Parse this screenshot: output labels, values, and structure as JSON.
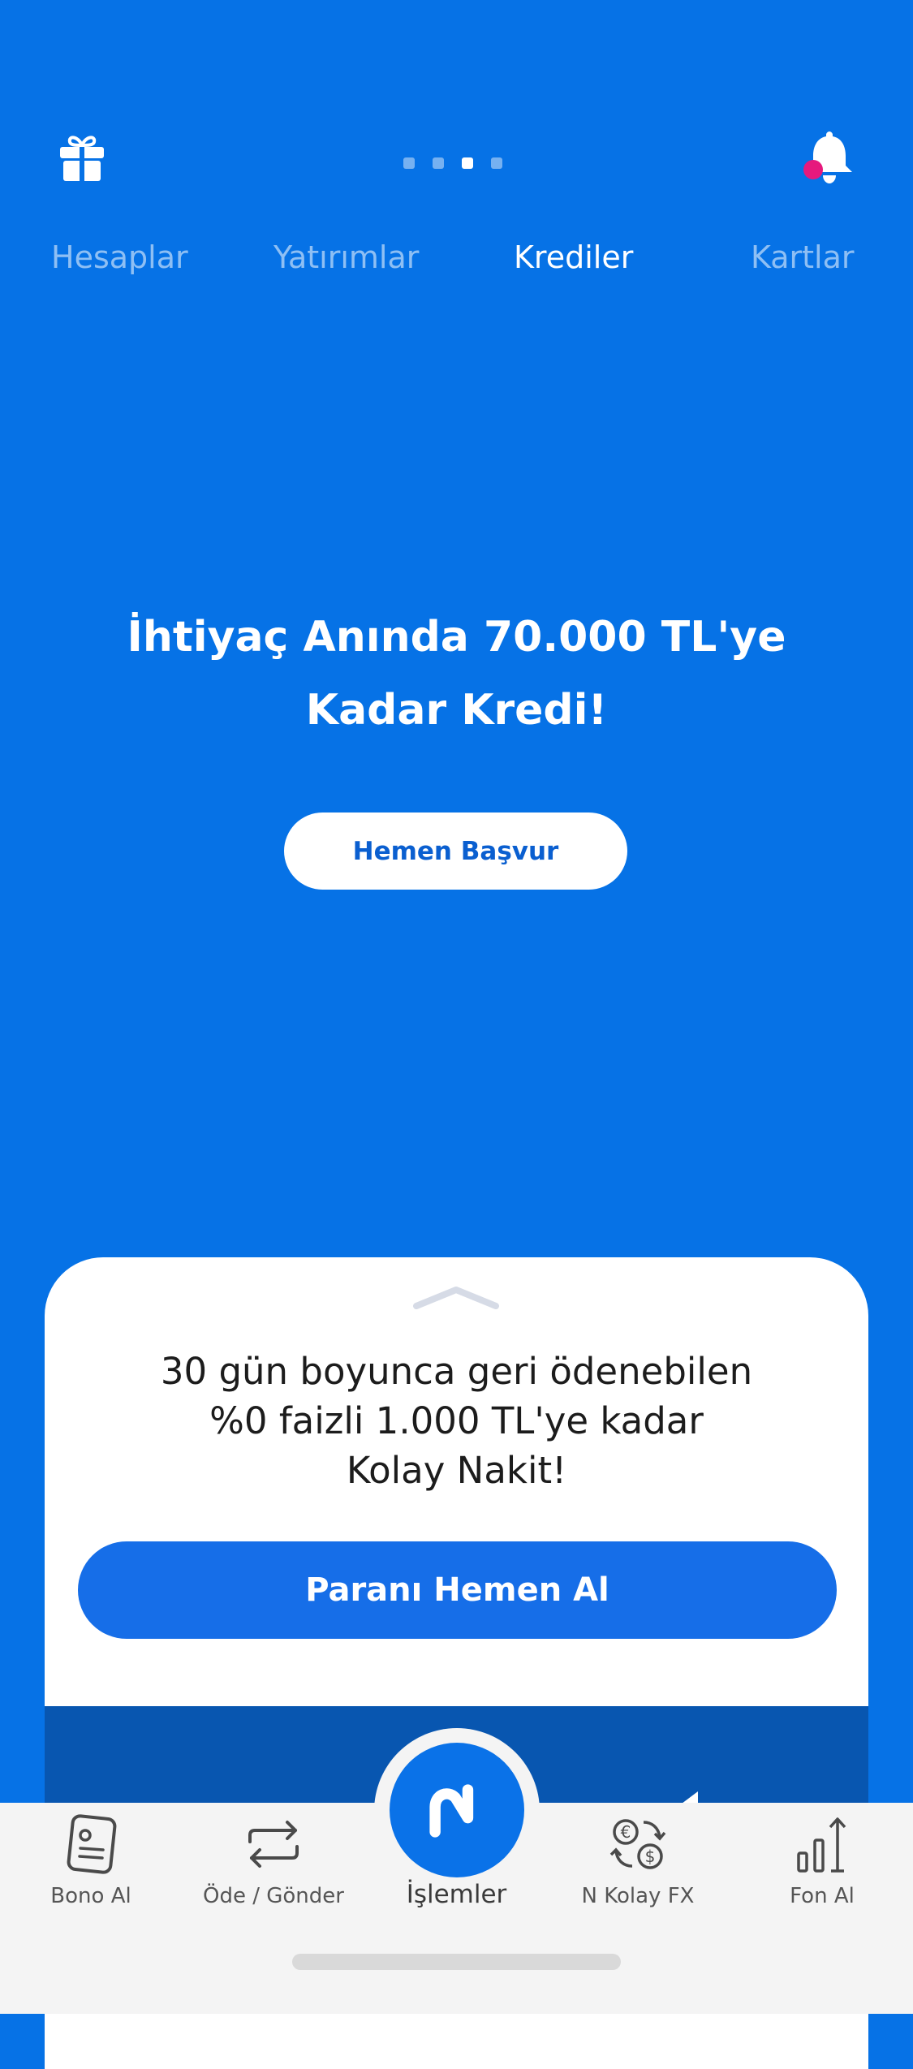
{
  "header": {
    "gift_icon": "gift-icon",
    "bell_icon": "bell-icon",
    "notification_badge_color": "#e6197d",
    "page_indicator": {
      "count": 4,
      "active_index": 2
    }
  },
  "tabs": [
    {
      "label": "Hesaplar",
      "active": false
    },
    {
      "label": "Yatırımlar",
      "active": false
    },
    {
      "label": "Krediler",
      "active": true
    },
    {
      "label": "Kartlar",
      "active": false
    }
  ],
  "hero": {
    "title": "İhtiyaç Anında 70.000 TL'ye Kadar Kredi!",
    "button_label": "Hemen Başvur"
  },
  "sheet": {
    "handle_icon": "chevron-up-icon",
    "text_lines": [
      "30 gün boyunca geri ödenebilen",
      "%0 faizli 1.000 TL'ye kadar",
      "Kolay Nakit!"
    ],
    "button_label": "Paranı Hemen Al"
  },
  "bottom_nav": {
    "items": [
      {
        "label": "Bono Al",
        "icon": "document-icon"
      },
      {
        "label": "Öde / Gönder",
        "icon": "transfer-arrows-icon"
      },
      {
        "label": "N Kolay FX",
        "icon": "currency-exchange-icon"
      },
      {
        "label": "Fon Al",
        "icon": "bar-chart-up-icon"
      }
    ],
    "center": {
      "label": "İşlemler",
      "icon": "n-logo-icon"
    }
  },
  "colors": {
    "background": "#0672e6",
    "primary_button": "#166ee8",
    "sheet_footer": "#0856b0",
    "nav_background": "#f4f4f4"
  }
}
